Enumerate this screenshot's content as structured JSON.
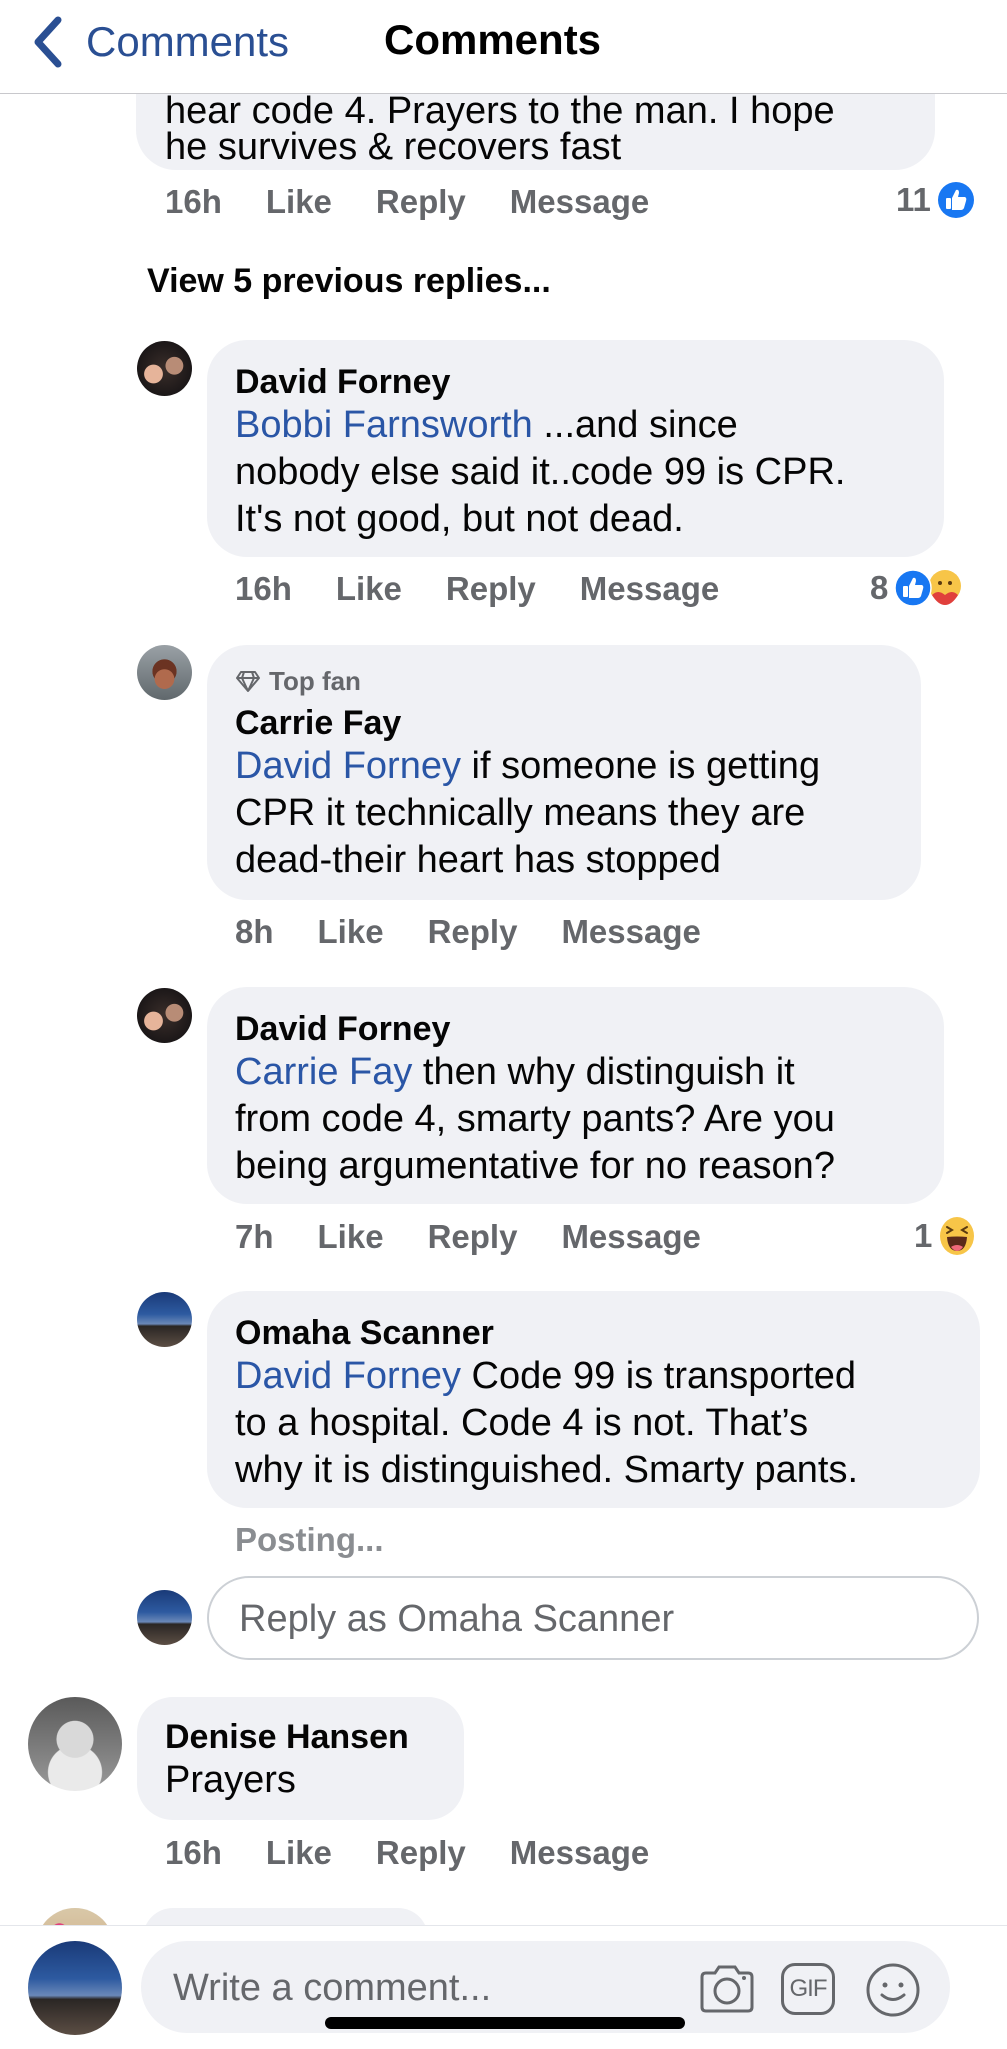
{
  "header": {
    "back_label": "Comments",
    "title": "Comments",
    "back_icon": "chevron-left-icon"
  },
  "colors": {
    "link_blue": "#2a4f93",
    "mention_blue": "#2a56a6",
    "bubble_bg": "#f0f1f5",
    "meta_gray": "#65676b",
    "like_blue": "#1877f2"
  },
  "top_comment": {
    "clipped_text": "hear code 4. Prayers to the man. I hope",
    "text": "he survives & recovers fast",
    "time": "16h",
    "like": "Like",
    "reply": "Reply",
    "message": "Message",
    "reaction_count": "11",
    "reactions": [
      "like"
    ]
  },
  "view_previous": "View 5 previous replies...",
  "replies": [
    {
      "author": "David Forney",
      "mention": "Bobbi Farnsworth",
      "lines": [
        " ...and since",
        "nobody else said it..code 99 is CPR.",
        "It's not good, but not dead."
      ],
      "time": "16h",
      "like": "Like",
      "reply": "Reply",
      "message": "Message",
      "reaction_count": "8",
      "reactions": [
        "like",
        "care"
      ]
    },
    {
      "badge": "Top fan",
      "author": "Carrie Fay",
      "mention": "David Forney",
      "lines": [
        " if someone is getting",
        "CPR it technically means they are",
        "dead-their heart has stopped"
      ],
      "time": "8h",
      "like": "Like",
      "reply": "Reply",
      "message": "Message"
    },
    {
      "author": "David Forney",
      "mention": "Carrie Fay",
      "lines": [
        " then why distinguish it",
        "from code 4, smarty pants? Are you",
        "being argumentative for no reason?"
      ],
      "time": "7h",
      "like": "Like",
      "reply": "Reply",
      "message": "Message",
      "reaction_count": "1",
      "reactions": [
        "haha"
      ]
    },
    {
      "author": "Omaha Scanner",
      "mention": "David Forney",
      "lines": [
        " Code 99 is transported",
        "to a hospital. Code 4 is not. That’s",
        "why it is distinguished. Smarty pants."
      ],
      "status": "Posting..."
    }
  ],
  "reply_input": {
    "placeholder": "Reply as Omaha Scanner",
    "value": ""
  },
  "comment_denise": {
    "author": "Denise Hansen",
    "text": "Prayers",
    "time": "16h",
    "like": "Like",
    "reply": "Reply",
    "message": "Message"
  },
  "composer": {
    "placeholder": "Write a comment...",
    "value": "",
    "gif_label": "GIF"
  }
}
